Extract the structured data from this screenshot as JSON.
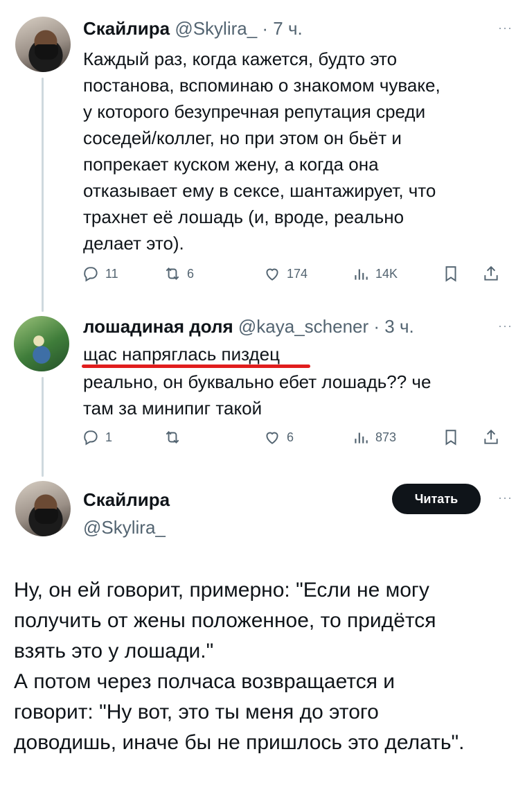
{
  "tweet1": {
    "name": "Скайлира",
    "handle": "@Skylira_",
    "time": "· 7 ч.",
    "more": "···",
    "text": "Каждый раз, когда кажется, будто это\nпостанова, вспоминаю о знакомом чуваке,\nу которого безупречная репутация среди\nсоседей/коллег, но при этом он бьёт и\nпопрекает куском жену, а когда она\nотказывает ему в сексе, шантажирует, что\nтрахнет её лошадь (и, вроде, реально\nделает это).",
    "actions": {
      "replies": "11",
      "retweets": "6",
      "likes": "174",
      "views": "14K"
    }
  },
  "tweet2": {
    "name": "лошадиная доля",
    "handle": "@kaya_schener",
    "time": "· 3 ч.",
    "more": "···",
    "text_line1": "щас напряглась пиздец",
    "text_rest": "реально, он буквально ебет лошадь?? че\nтам за минипиг такой",
    "actions": {
      "replies": "1",
      "retweets": "",
      "likes": "6",
      "views": "873"
    }
  },
  "tweet3": {
    "name": "Скайлира",
    "handle": "@Skylira_",
    "follow_label": "Читать",
    "more": "···",
    "text": "Ну, он ей говорит, примерно: \"Если не могу\nполучить от жены положенное, то придётся\nвзять это у лошади.\"\nА потом через полчаса возвращается и\nговорит: \"Ну вот, это ты меня до этого\nдоводишь, иначе бы не пришлось это делать\"."
  },
  "colors": {
    "text": "#0f1419",
    "secondary": "#536471",
    "accent_red": "#e11d1d"
  }
}
